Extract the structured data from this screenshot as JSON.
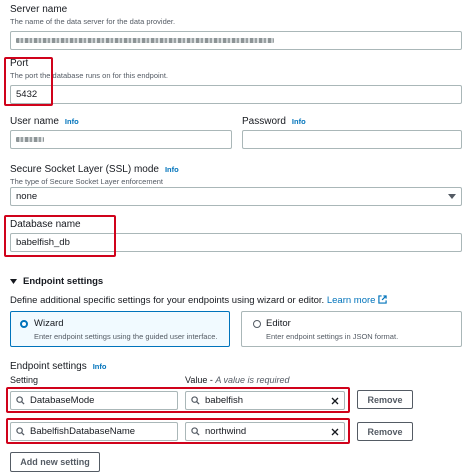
{
  "server": {
    "label": "Server name",
    "description": "The name of the data server for the data provider."
  },
  "port": {
    "label": "Port",
    "description": "The port the database runs on for this endpoint.",
    "value": "5432"
  },
  "username": {
    "label": "User name",
    "info": "Info"
  },
  "password": {
    "label": "Password",
    "info": "Info"
  },
  "ssl": {
    "label": "Secure Socket Layer (SSL) mode",
    "info": "Info",
    "description": "The type of Secure Socket Layer enforcement",
    "value": "none"
  },
  "database": {
    "label": "Database name",
    "value": "babelfish_db"
  },
  "endpoint_settings_section": {
    "title": "Endpoint settings",
    "intro": "Define additional specific settings for your endpoints using wizard or editor.",
    "learn_more": "Learn more"
  },
  "mode": {
    "wizard": {
      "title": "Wizard",
      "description": "Enter endpoint settings using the guided user interface.",
      "selected": true
    },
    "editor": {
      "title": "Editor",
      "description": "Enter endpoint settings in JSON format.",
      "selected": false
    }
  },
  "settings": {
    "label": "Endpoint settings",
    "info": "Info",
    "setting_header": "Setting",
    "value_header": "Value - ",
    "value_required": "A value is required",
    "rows": [
      {
        "setting": "DatabaseMode",
        "value": "babelfish",
        "remove": "Remove"
      },
      {
        "setting": "BabelfishDatabaseName",
        "value": "northwind",
        "remove": "Remove"
      }
    ],
    "add_new": "Add new setting"
  },
  "colors": {
    "accent": "#0073bb",
    "highlight": "#d0021b",
    "selected_bg": "#f1faff"
  }
}
